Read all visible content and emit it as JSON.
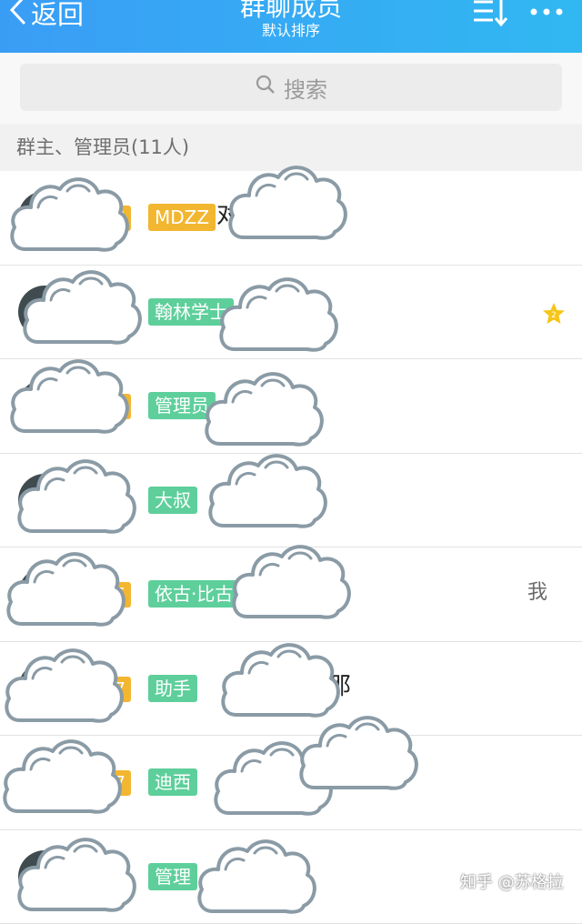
{
  "header": {
    "back_label": "返回",
    "title": "群聊成员",
    "subtitle": "默认排序"
  },
  "search": {
    "placeholder": "搜索"
  },
  "section": {
    "title": "群主、管理员(11人)"
  },
  "members": [
    {
      "level": "V6",
      "tag": "MDZZ",
      "tag_color": "#f2b630",
      "name": "对",
      "extra": ""
    },
    {
      "level": "",
      "tag": "翰林学士",
      "tag_color": "#5ecf9b",
      "name": "",
      "extra": ""
    },
    {
      "level": "V7",
      "tag": "管理员",
      "tag_color": "#5ecf9b",
      "name": "",
      "extra": ""
    },
    {
      "level": "",
      "tag": "大叔",
      "tag_color": "#5ecf9b",
      "name": "",
      "extra": ""
    },
    {
      "level": "V6",
      "tag": "依古·比古",
      "tag_color": "#5ecf9b",
      "name": "",
      "extra": "我"
    },
    {
      "level": "V7",
      "tag": "助手",
      "tag_color": "#5ecf9b",
      "name": "那",
      "extra": ""
    },
    {
      "level": "V7",
      "tag": "迪西",
      "tag_color": "#5ecf9b",
      "name": "...",
      "extra": ""
    },
    {
      "level": "",
      "tag": "管理",
      "tag_color": "#5ecf9b",
      "name": "",
      "extra": ""
    }
  ],
  "watermark": "知乎 @苏格拉",
  "colors": {
    "header_gradient_start": "#3a9df5",
    "header_gradient_end": "#31b8f2",
    "level_badge": "#f2b630",
    "tag_green": "#5ecf9b",
    "star": "#f5c518"
  }
}
